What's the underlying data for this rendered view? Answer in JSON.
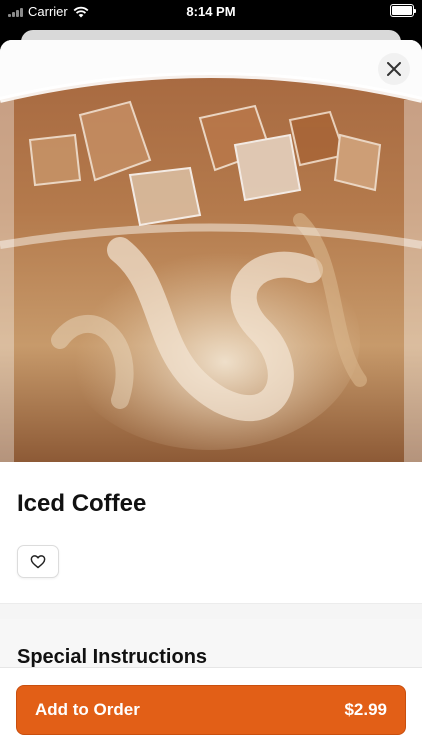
{
  "status_bar": {
    "carrier": "Carrier",
    "time": "8:14 PM"
  },
  "item": {
    "title": "Iced Coffee",
    "image_icon": "iced-coffee-photo"
  },
  "icons": {
    "close": "close-icon",
    "favorite": "heart-icon",
    "wifi": "wifi-icon",
    "battery": "battery-icon",
    "signal": "signal-icon"
  },
  "sections": {
    "special_instructions_title": "Special Instructions"
  },
  "order_button": {
    "label": "Add to Order",
    "price": "$2.99"
  },
  "colors": {
    "accent": "#E25F17"
  }
}
